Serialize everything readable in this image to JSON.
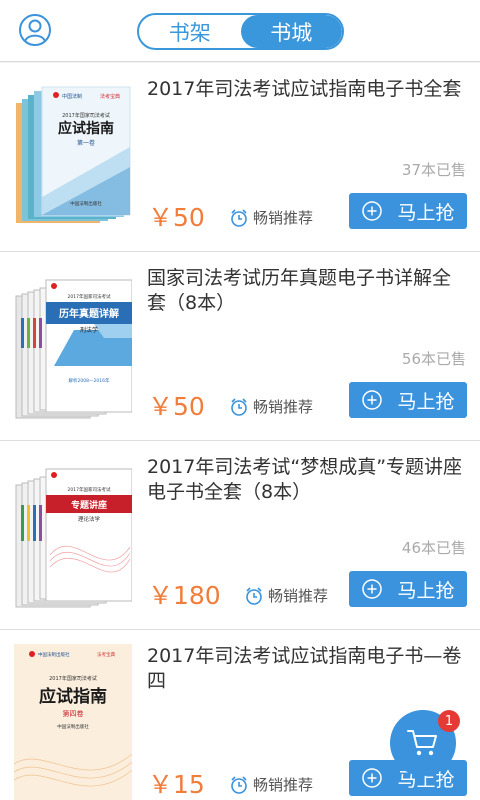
{
  "header": {
    "tabs": [
      {
        "label": "书架",
        "active": false
      },
      {
        "label": "书城",
        "active": true
      }
    ]
  },
  "colors": {
    "accent": "#3a93dc",
    "price": "#f07d3a",
    "badge": "#e53935"
  },
  "products": [
    {
      "title": "2017年司法考试应试指南电子书全套",
      "sold": "37本已售",
      "price": "￥50",
      "tag": "畅销推荐",
      "buy_label": "马上抢",
      "cover": {
        "style": "light-blue",
        "heading": "应试指南",
        "subheading": "第一卷",
        "year_line": "2017年国家司法考试",
        "brand": "中国法制出版社"
      }
    },
    {
      "title": "国家司法考试历年真题电子书详解全套（8本）",
      "sold": "56本已售",
      "price": "￥50",
      "tag": "畅销推荐",
      "buy_label": "马上抢",
      "cover": {
        "style": "blue-stack",
        "heading": "历年真题详解",
        "subheading": "刑法学",
        "year_line": "2017年国家司法考试",
        "footer": "解析2008—2016年"
      }
    },
    {
      "title": "2017年司法考试“梦想成真”专题讲座电子书全套（8本）",
      "sold": "46本已售",
      "price": "￥180",
      "tag": "畅销推荐",
      "buy_label": "马上抢",
      "cover": {
        "style": "red-stack",
        "heading": "专题讲座",
        "subheading": "理论法学",
        "year_line": "2017年国家司法考试"
      }
    },
    {
      "title": "2017年司法考试应试指南电子书—卷四",
      "sold": "",
      "price": "￥15",
      "tag": "畅销推荐",
      "buy_label": "马上抢",
      "cover": {
        "style": "cream",
        "heading": "应试指南",
        "subheading": "第四卷",
        "year_line": "2017年国家司法考试",
        "brand": "中国法制出版社"
      }
    }
  ],
  "cart": {
    "count": "1"
  }
}
